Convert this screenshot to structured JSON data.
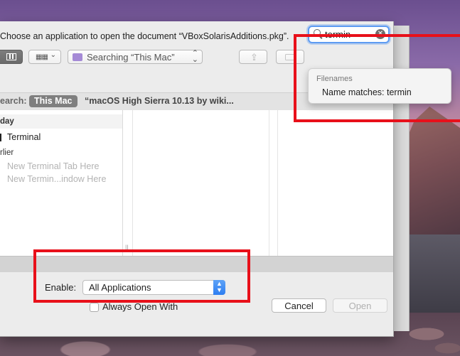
{
  "dialog": {
    "prompt": "Choose an application to open the document “VBoxSolarisAdditions.pkg”."
  },
  "toolbar": {
    "view_icon": "column-view-icon",
    "arrange_icon": "grid-arrange-icon",
    "location": "Searching “This Mac”",
    "share_icon": "share-icon",
    "tag_icon": "tag-icon"
  },
  "search": {
    "value": "termin",
    "clear_icon": "✕"
  },
  "suggestions": {
    "header": "Filenames",
    "item": "Name matches: termin"
  },
  "scope": {
    "label": "earch:",
    "selected": "This Mac",
    "other": "“macOS High Sierra 10.13 by wiki..."
  },
  "results": {
    "section_today": "day",
    "items_today": [
      "Terminal"
    ],
    "section_earlier": "rlier",
    "items_earlier": [
      "New Terminal Tab Here",
      "New Termin...indow Here"
    ]
  },
  "options": {
    "enable_label": "Enable:",
    "enable_value": "All Applications",
    "always_open_label": "Always Open With",
    "always_open_checked": false
  },
  "buttons": {
    "cancel": "Cancel",
    "open": "Open"
  },
  "colors": {
    "annotation": "#e8101a",
    "focus": "#5d9bf2"
  }
}
